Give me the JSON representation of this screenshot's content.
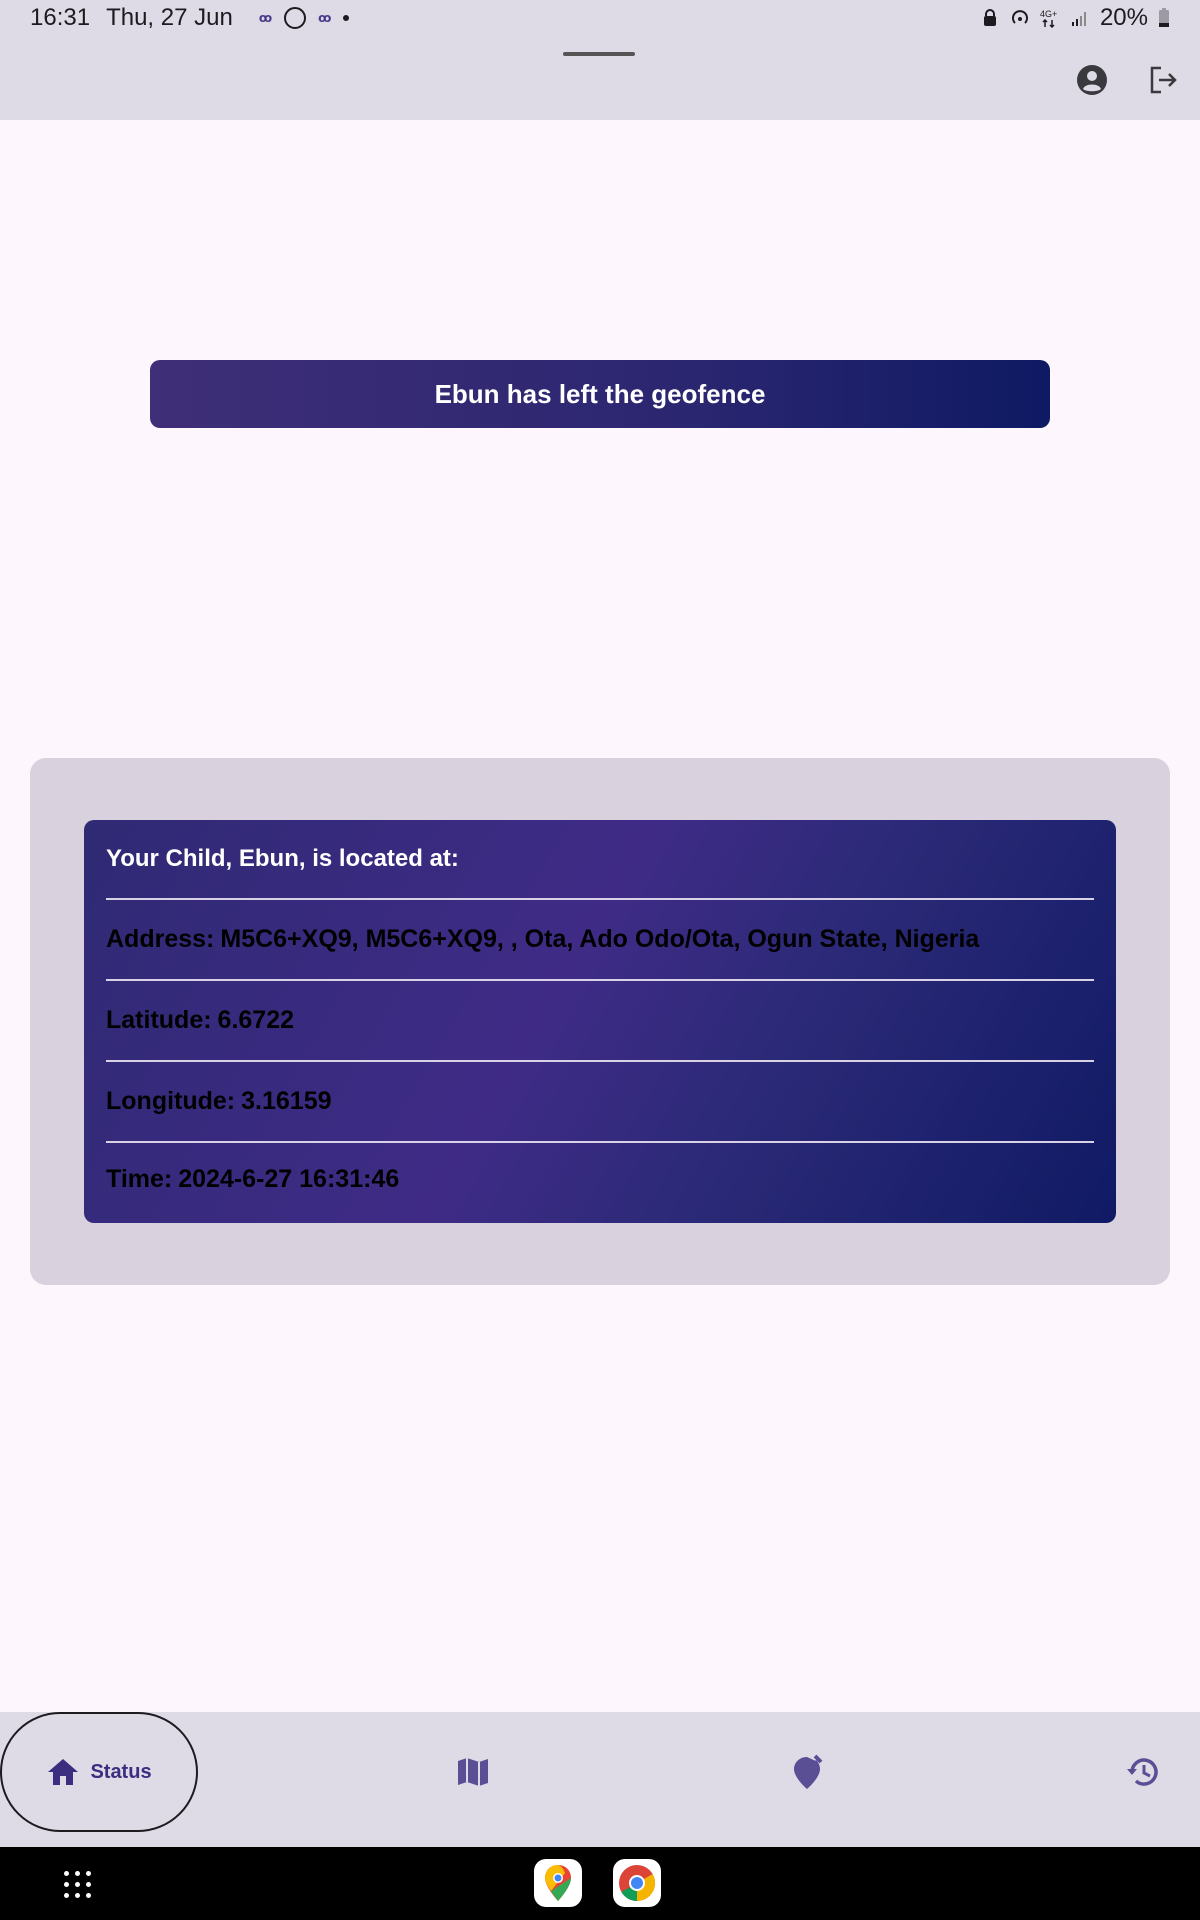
{
  "status_bar": {
    "time": "16:31",
    "date": "Thu, 27 Jun",
    "battery": "20%",
    "icons": [
      "app-notification-icon",
      "whatsapp-icon",
      "app-notification-icon",
      "more-dot-icon",
      "lock-icon",
      "hotspot-icon",
      "network-4g-icon",
      "signal-icon",
      "battery-icon"
    ]
  },
  "app_bar": {
    "actions": [
      "account-circle-icon",
      "logout-icon"
    ]
  },
  "banner": {
    "text": "Ebun has left the geofence"
  },
  "location_card": {
    "heading": "Your Child, Ebun, is located at:",
    "address_label": "Address:",
    "address_value": "M5C6+XQ9, M5C6+XQ9, , Ota, Ado Odo/Ota, Ogun State, Nigeria",
    "latitude_label": "Latitude:",
    "latitude_value": "6.6722",
    "longitude_label": "Longitude:",
    "longitude_value": "3.16159",
    "time_label": "Time:",
    "time_value": "2024-6-27 16:31:46"
  },
  "bottom_nav": {
    "items": [
      {
        "label": "Status",
        "icon": "home-icon",
        "selected": true
      },
      {
        "label": "",
        "icon": "map-icon",
        "selected": false
      },
      {
        "label": "",
        "icon": "geofence-edit-icon",
        "selected": false
      },
      {
        "label": "",
        "icon": "history-icon",
        "selected": false
      }
    ]
  },
  "system_nav": {
    "dock": [
      "google-maps-icon",
      "chrome-icon"
    ]
  },
  "colors": {
    "accent": "#3b2d80",
    "banner_start": "#3f2e78",
    "banner_end": "#0e1a63",
    "surface": "#dedbe6",
    "card_outer": "#d9d1dd",
    "background": "#fdf7fd"
  }
}
